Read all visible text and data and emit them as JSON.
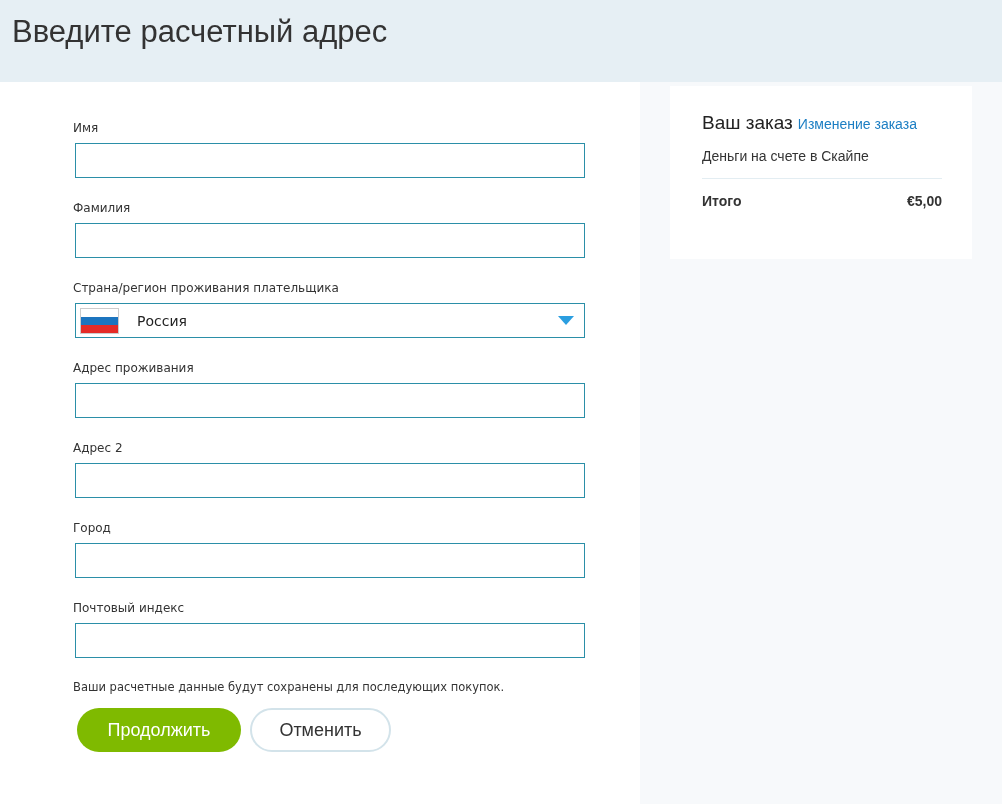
{
  "header": {
    "title": "Введите расчетный адрес"
  },
  "form": {
    "fields": [
      {
        "kind": "text",
        "label": "Имя"
      },
      {
        "kind": "text",
        "label": "Фамилия"
      },
      {
        "kind": "select",
        "label": "Страна/регион проживания плательщика",
        "value": "Россия"
      },
      {
        "kind": "text",
        "label": "Адрес проживания"
      },
      {
        "kind": "text",
        "label": "Адрес 2"
      },
      {
        "kind": "text",
        "label": "Город"
      },
      {
        "kind": "text",
        "label": "Почтовый индекс"
      }
    ],
    "note": "Ваши расчетные данные будут сохранены для последующих покупок.",
    "buttons": [
      {
        "kind": "primary",
        "label": "Продолжить"
      },
      {
        "kind": "secondary",
        "label": "Отменить"
      }
    ]
  },
  "order": {
    "title": "Ваш заказ",
    "edit_link": "Изменение заказа",
    "item": "Деньги на счете в Скайпе",
    "total_label": "Итого",
    "total_value": "€5,00"
  }
}
